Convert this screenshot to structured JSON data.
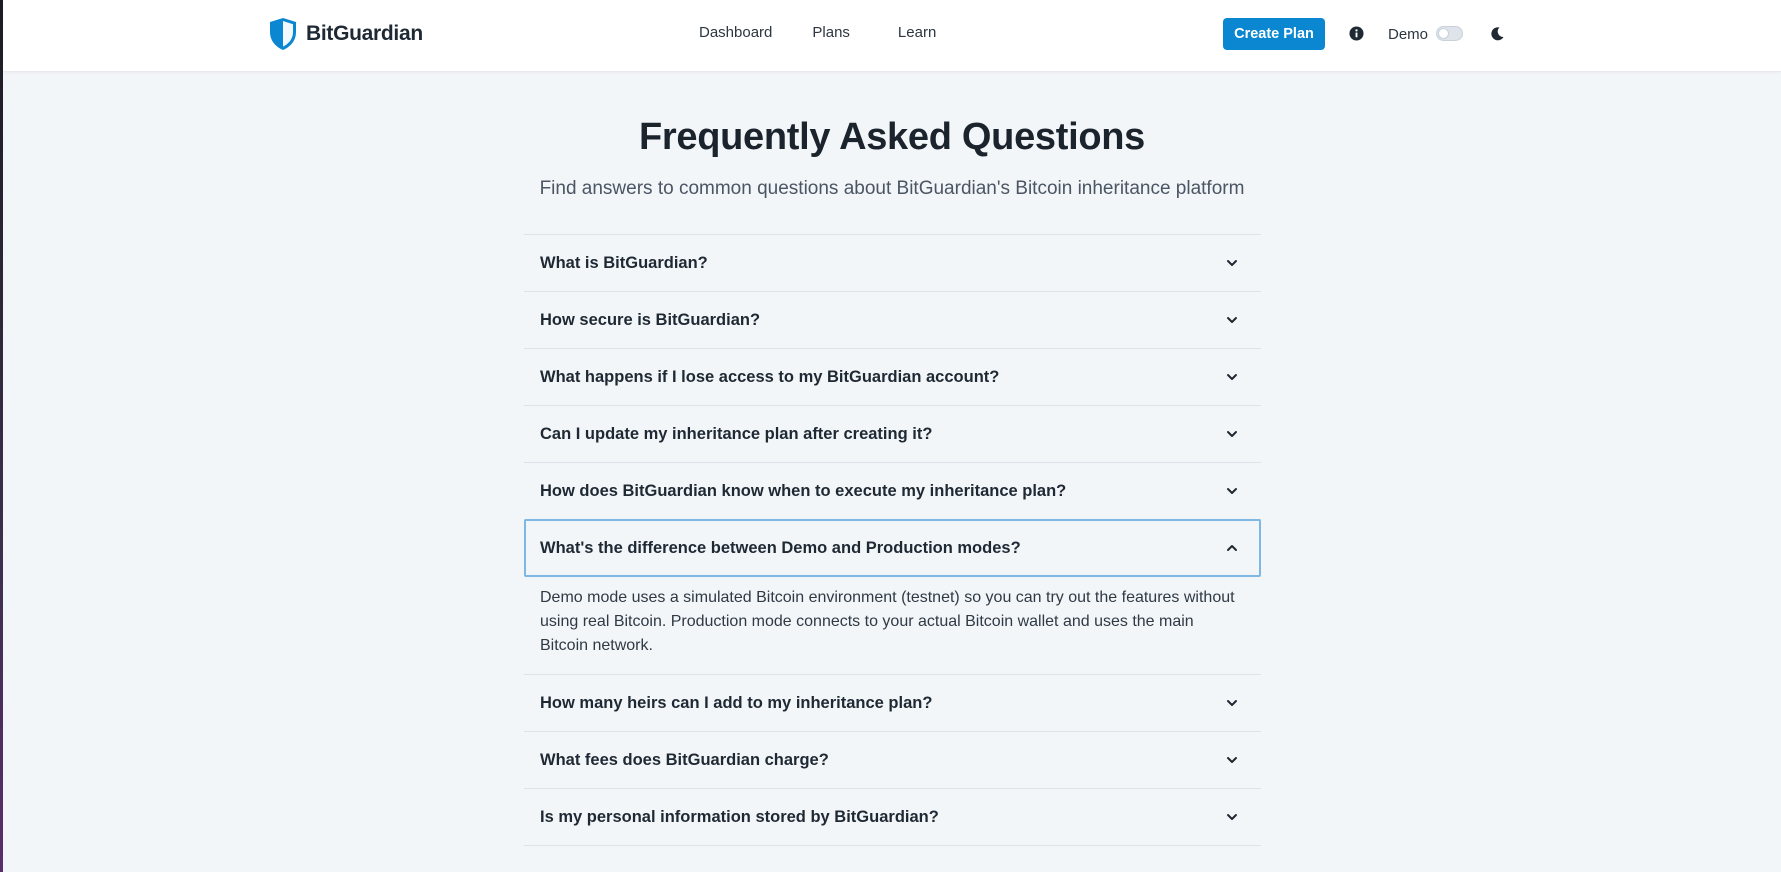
{
  "brand": {
    "name": "BitGuardian",
    "icon": "shield-icon"
  },
  "nav": {
    "dashboard": "Dashboard",
    "plans": "Plans",
    "learn": "Learn"
  },
  "header": {
    "create_plan": "Create Plan",
    "demo_label": "Demo",
    "demo_toggle_on": false
  },
  "colors": {
    "accent": "#0b87d1",
    "background": "#f3f6f9",
    "focus_outline": "#7fb7e3"
  },
  "page": {
    "title": "Frequently Asked Questions",
    "subtitle": "Find answers to common questions about BitGuardian's Bitcoin inheritance platform"
  },
  "faq": [
    {
      "question": "What is BitGuardian?",
      "open": false
    },
    {
      "question": "How secure is BitGuardian?",
      "open": false
    },
    {
      "question": "What happens if I lose access to my BitGuardian account?",
      "open": false
    },
    {
      "question": "Can I update my inheritance plan after creating it?",
      "open": false
    },
    {
      "question": "How does BitGuardian know when to execute my inheritance plan?",
      "open": false
    },
    {
      "question": "What's the difference between Demo and Production modes?",
      "open": true,
      "answer": "Demo mode uses a simulated Bitcoin environment (testnet) so you can try out the features without using real Bitcoin. Production mode connects to your actual Bitcoin wallet and uses the main Bitcoin network."
    },
    {
      "question": "How many heirs can I add to my inheritance plan?",
      "open": false
    },
    {
      "question": "What fees does BitGuardian charge?",
      "open": false
    },
    {
      "question": "Is my personal information stored by BitGuardian?",
      "open": false
    }
  ]
}
